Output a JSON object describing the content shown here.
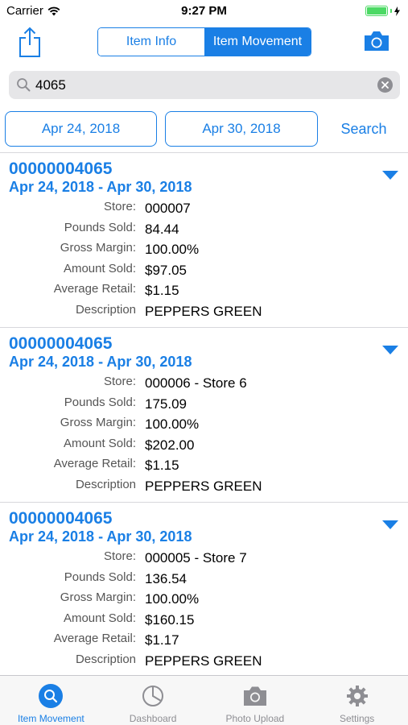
{
  "status_bar": {
    "carrier": "Carrier",
    "time": "9:27 PM"
  },
  "nav": {
    "segments": [
      "Item Info",
      "Item Movement"
    ],
    "active_segment": "Item Movement",
    "left_icon": "share-icon",
    "right_icon": "camera-icon"
  },
  "search": {
    "value": "4065",
    "placeholder": ""
  },
  "filters": {
    "start_date": "Apr 24, 2018",
    "end_date": "Apr 30, 2018",
    "search_label": "Search"
  },
  "labels": {
    "store": "Store:",
    "pounds_sold": "Pounds Sold:",
    "gross_margin": "Gross Margin:",
    "amount_sold": "Amount Sold:",
    "average_retail": "Average Retail:",
    "description": "Description"
  },
  "results": [
    {
      "item": "00000004065",
      "range": "Apr 24, 2018 - Apr 30, 2018",
      "store": "000007",
      "pounds_sold": "84.44",
      "gross_margin": "100.00%",
      "amount_sold": "$97.05",
      "average_retail": "$1.15",
      "description": "PEPPERS GREEN"
    },
    {
      "item": "00000004065",
      "range": "Apr 24, 2018 - Apr 30, 2018",
      "store": "000006 - Store 6",
      "pounds_sold": "175.09",
      "gross_margin": "100.00%",
      "amount_sold": "$202.00",
      "average_retail": "$1.15",
      "description": "PEPPERS GREEN"
    },
    {
      "item": "00000004065",
      "range": "Apr 24, 2018 - Apr 30, 2018",
      "store": "000005 - Store 7",
      "pounds_sold": "136.54",
      "gross_margin": "100.00%",
      "amount_sold": "$160.15",
      "average_retail": "$1.17",
      "description": "PEPPERS GREEN"
    }
  ],
  "tabs": [
    {
      "label": "Item Movement",
      "icon": "search-icon",
      "active": true
    },
    {
      "label": "Dashboard",
      "icon": "pie-chart-icon",
      "active": false
    },
    {
      "label": "Photo Upload",
      "icon": "camera-icon",
      "active": false
    },
    {
      "label": "Settings",
      "icon": "gear-icon",
      "active": false
    }
  ],
  "colors": {
    "accent": "#1a7fe5",
    "battery": "#4cd964",
    "inactive": "#8e8e93"
  }
}
